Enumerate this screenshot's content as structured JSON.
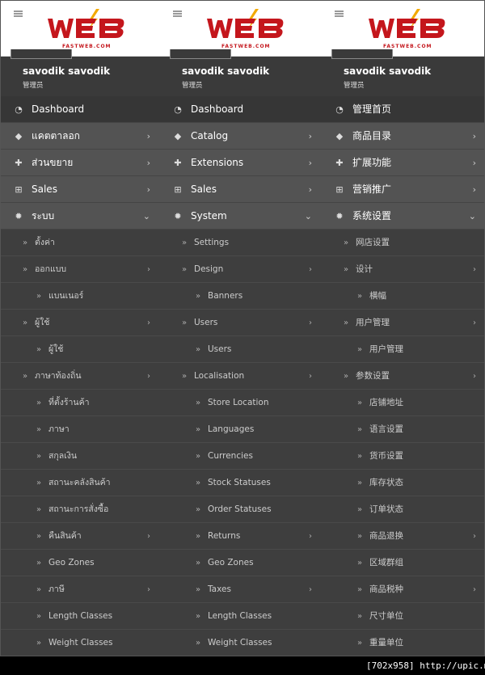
{
  "colors": {
    "accent": "#c4161c",
    "sidebar_bg": "#3a3a3a",
    "top_item_bg": "#535353"
  },
  "watermark": "[702x958] http://upic.me/",
  "columns": [
    {
      "logo_text": "WEB",
      "logo_sub": "FASTWEB.COM",
      "user_name": "savodik savodik",
      "user_role": "管理员",
      "items": [
        {
          "label": "Dashboard",
          "type": "top",
          "icon": "dashboard-icon",
          "glyph": "◔",
          "chevron": "",
          "active": true
        },
        {
          "label": "แคตตาลอก",
          "type": "top",
          "icon": "tag-icon",
          "glyph": "◆",
          "chevron": "›"
        },
        {
          "label": "ส่วนขยาย",
          "type": "top",
          "icon": "puzzle-icon",
          "glyph": "✚",
          "chevron": "›"
        },
        {
          "label": "Sales",
          "type": "top",
          "icon": "cart-icon",
          "glyph": "⊞",
          "chevron": "›"
        },
        {
          "label": "ระบบ",
          "type": "top",
          "icon": "gear-icon",
          "glyph": "✹",
          "chevron": "⌄"
        },
        {
          "label": "ตั้งค่า",
          "type": "l1",
          "chevron": ""
        },
        {
          "label": "ออกแบบ",
          "type": "l1",
          "chevron": "›"
        },
        {
          "label": "แบนเนอร์",
          "type": "l2",
          "chevron": ""
        },
        {
          "label": "ผู้ใช้",
          "type": "l1",
          "chevron": "›"
        },
        {
          "label": "ผู้ใช้",
          "type": "l2",
          "chevron": ""
        },
        {
          "label": "ภาษาท้องถิ่น",
          "type": "l1",
          "chevron": "›"
        },
        {
          "label": "ที่ตั้งร้านค้า",
          "type": "l2",
          "chevron": ""
        },
        {
          "label": "ภาษา",
          "type": "l2",
          "chevron": ""
        },
        {
          "label": "สกุลเงิน",
          "type": "l2",
          "chevron": ""
        },
        {
          "label": "สถานะคลังสินค้า",
          "type": "l2",
          "chevron": ""
        },
        {
          "label": "สถานะการสั่งซื้อ",
          "type": "l2",
          "chevron": ""
        },
        {
          "label": "คืนสินค้า",
          "type": "l2",
          "chevron": "›"
        },
        {
          "label": "Geo Zones",
          "type": "l2",
          "chevron": ""
        },
        {
          "label": "ภาษี",
          "type": "l2",
          "chevron": "›"
        },
        {
          "label": "Length Classes",
          "type": "l2",
          "chevron": ""
        },
        {
          "label": "Weight Classes",
          "type": "l2",
          "chevron": ""
        }
      ]
    },
    {
      "logo_text": "WEB",
      "logo_sub": "FASTWEB.COM",
      "user_name": "savodik savodik",
      "user_role": "管理员",
      "items": [
        {
          "label": "Dashboard",
          "type": "top",
          "icon": "dashboard-icon",
          "glyph": "◔",
          "chevron": "",
          "active": true
        },
        {
          "label": "Catalog",
          "type": "top",
          "icon": "tag-icon",
          "glyph": "◆",
          "chevron": "›"
        },
        {
          "label": "Extensions",
          "type": "top",
          "icon": "puzzle-icon",
          "glyph": "✚",
          "chevron": "›"
        },
        {
          "label": "Sales",
          "type": "top",
          "icon": "cart-icon",
          "glyph": "⊞",
          "chevron": "›"
        },
        {
          "label": "System",
          "type": "top",
          "icon": "gear-icon",
          "glyph": "✹",
          "chevron": "⌄"
        },
        {
          "label": "Settings",
          "type": "l1",
          "chevron": ""
        },
        {
          "label": "Design",
          "type": "l1",
          "chevron": "›"
        },
        {
          "label": "Banners",
          "type": "l2",
          "chevron": ""
        },
        {
          "label": "Users",
          "type": "l1",
          "chevron": "›"
        },
        {
          "label": "Users",
          "type": "l2",
          "chevron": ""
        },
        {
          "label": "Localisation",
          "type": "l1",
          "chevron": "›"
        },
        {
          "label": "Store Location",
          "type": "l2",
          "chevron": ""
        },
        {
          "label": "Languages",
          "type": "l2",
          "chevron": ""
        },
        {
          "label": "Currencies",
          "type": "l2",
          "chevron": ""
        },
        {
          "label": "Stock Statuses",
          "type": "l2",
          "chevron": ""
        },
        {
          "label": "Order Statuses",
          "type": "l2",
          "chevron": ""
        },
        {
          "label": "Returns",
          "type": "l2",
          "chevron": "›"
        },
        {
          "label": "Geo Zones",
          "type": "l2",
          "chevron": ""
        },
        {
          "label": "Taxes",
          "type": "l2",
          "chevron": "›"
        },
        {
          "label": "Length Classes",
          "type": "l2",
          "chevron": ""
        },
        {
          "label": "Weight Classes",
          "type": "l2",
          "chevron": ""
        }
      ]
    },
    {
      "logo_text": "WEB",
      "logo_sub": "FASTWEB.COM",
      "user_name": "savodik savodik",
      "user_role": "管理员",
      "items": [
        {
          "label": "管理首页",
          "type": "top",
          "icon": "dashboard-icon",
          "glyph": "◔",
          "chevron": "",
          "active": true
        },
        {
          "label": "商品目录",
          "type": "top",
          "icon": "tag-icon",
          "glyph": "◆",
          "chevron": "›"
        },
        {
          "label": "扩展功能",
          "type": "top",
          "icon": "puzzle-icon",
          "glyph": "✚",
          "chevron": "›"
        },
        {
          "label": "营销推广",
          "type": "top",
          "icon": "cart-icon",
          "glyph": "⊞",
          "chevron": "›"
        },
        {
          "label": "系统设置",
          "type": "top",
          "icon": "gear-icon",
          "glyph": "✹",
          "chevron": "⌄"
        },
        {
          "label": "网店设置",
          "type": "l1",
          "chevron": ""
        },
        {
          "label": "设计",
          "type": "l1",
          "chevron": "›"
        },
        {
          "label": "横幅",
          "type": "l2",
          "chevron": ""
        },
        {
          "label": "用户管理",
          "type": "l1",
          "chevron": "›"
        },
        {
          "label": "用户管理",
          "type": "l2",
          "chevron": ""
        },
        {
          "label": "参数设置",
          "type": "l1",
          "chevron": "›"
        },
        {
          "label": "店铺地址",
          "type": "l2",
          "chevron": ""
        },
        {
          "label": "语言设置",
          "type": "l2",
          "chevron": ""
        },
        {
          "label": "货币设置",
          "type": "l2",
          "chevron": ""
        },
        {
          "label": "库存状态",
          "type": "l2",
          "chevron": ""
        },
        {
          "label": "订单状态",
          "type": "l2",
          "chevron": ""
        },
        {
          "label": "商品退换",
          "type": "l2",
          "chevron": "›"
        },
        {
          "label": "区域群组",
          "type": "l2",
          "chevron": ""
        },
        {
          "label": "商品税种",
          "type": "l2",
          "chevron": "›"
        },
        {
          "label": "尺寸单位",
          "type": "l2",
          "chevron": ""
        },
        {
          "label": "重量单位",
          "type": "l2",
          "chevron": ""
        }
      ]
    }
  ]
}
